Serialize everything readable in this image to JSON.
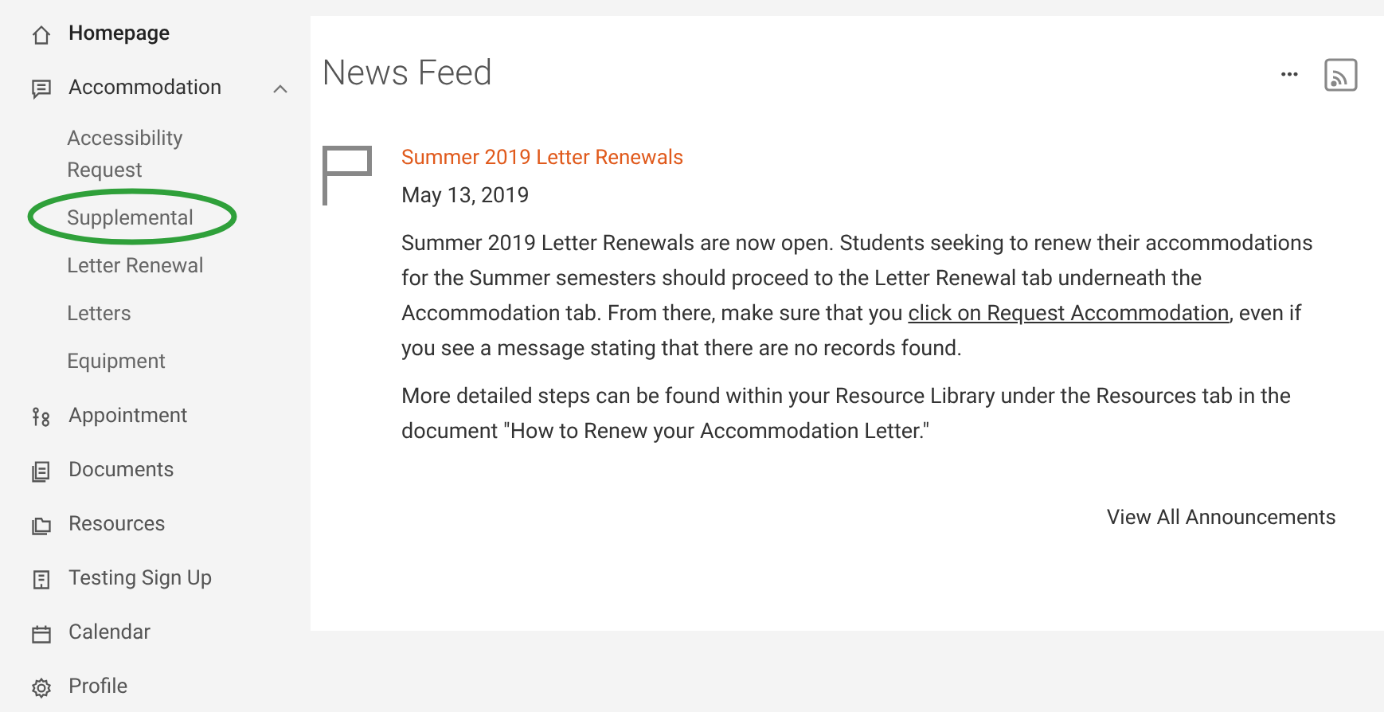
{
  "sidebar": {
    "items": [
      {
        "label": "Homepage"
      },
      {
        "label": "Accommodation",
        "expanded": true,
        "children": [
          {
            "label": "Accessibility Request",
            "circled": false
          },
          {
            "label": "Supplemental",
            "circled": true
          },
          {
            "label": "Letter Renewal",
            "circled": false
          },
          {
            "label": "Letters",
            "circled": false
          },
          {
            "label": "Equipment",
            "circled": false
          }
        ]
      },
      {
        "label": "Appointment"
      },
      {
        "label": "Documents"
      },
      {
        "label": "Resources"
      },
      {
        "label": "Testing Sign Up"
      },
      {
        "label": "Calendar"
      },
      {
        "label": "Profile"
      }
    ]
  },
  "feed": {
    "title": "News Feed",
    "more": "···",
    "announcement": {
      "title": "Summer 2019 Letter Renewals",
      "date": "May 13, 2019",
      "paragraphs": [
        {
          "before": "Summer 2019 Letter Renewals are now open. Students seeking to renew their accommodations for the Summer semesters should proceed to the Letter Renewal tab underneath the Accommodation tab. From there, make sure that you ",
          "link": "click on Request Accommodation",
          "after": ", even if you see a message stating that there are no records found."
        },
        {
          "before": "More detailed steps can be found within your Resource Library under the Resources tab in the document \"How to Renew your Accommodation Letter.\""
        }
      ]
    },
    "view_all": "View All Announcements"
  }
}
